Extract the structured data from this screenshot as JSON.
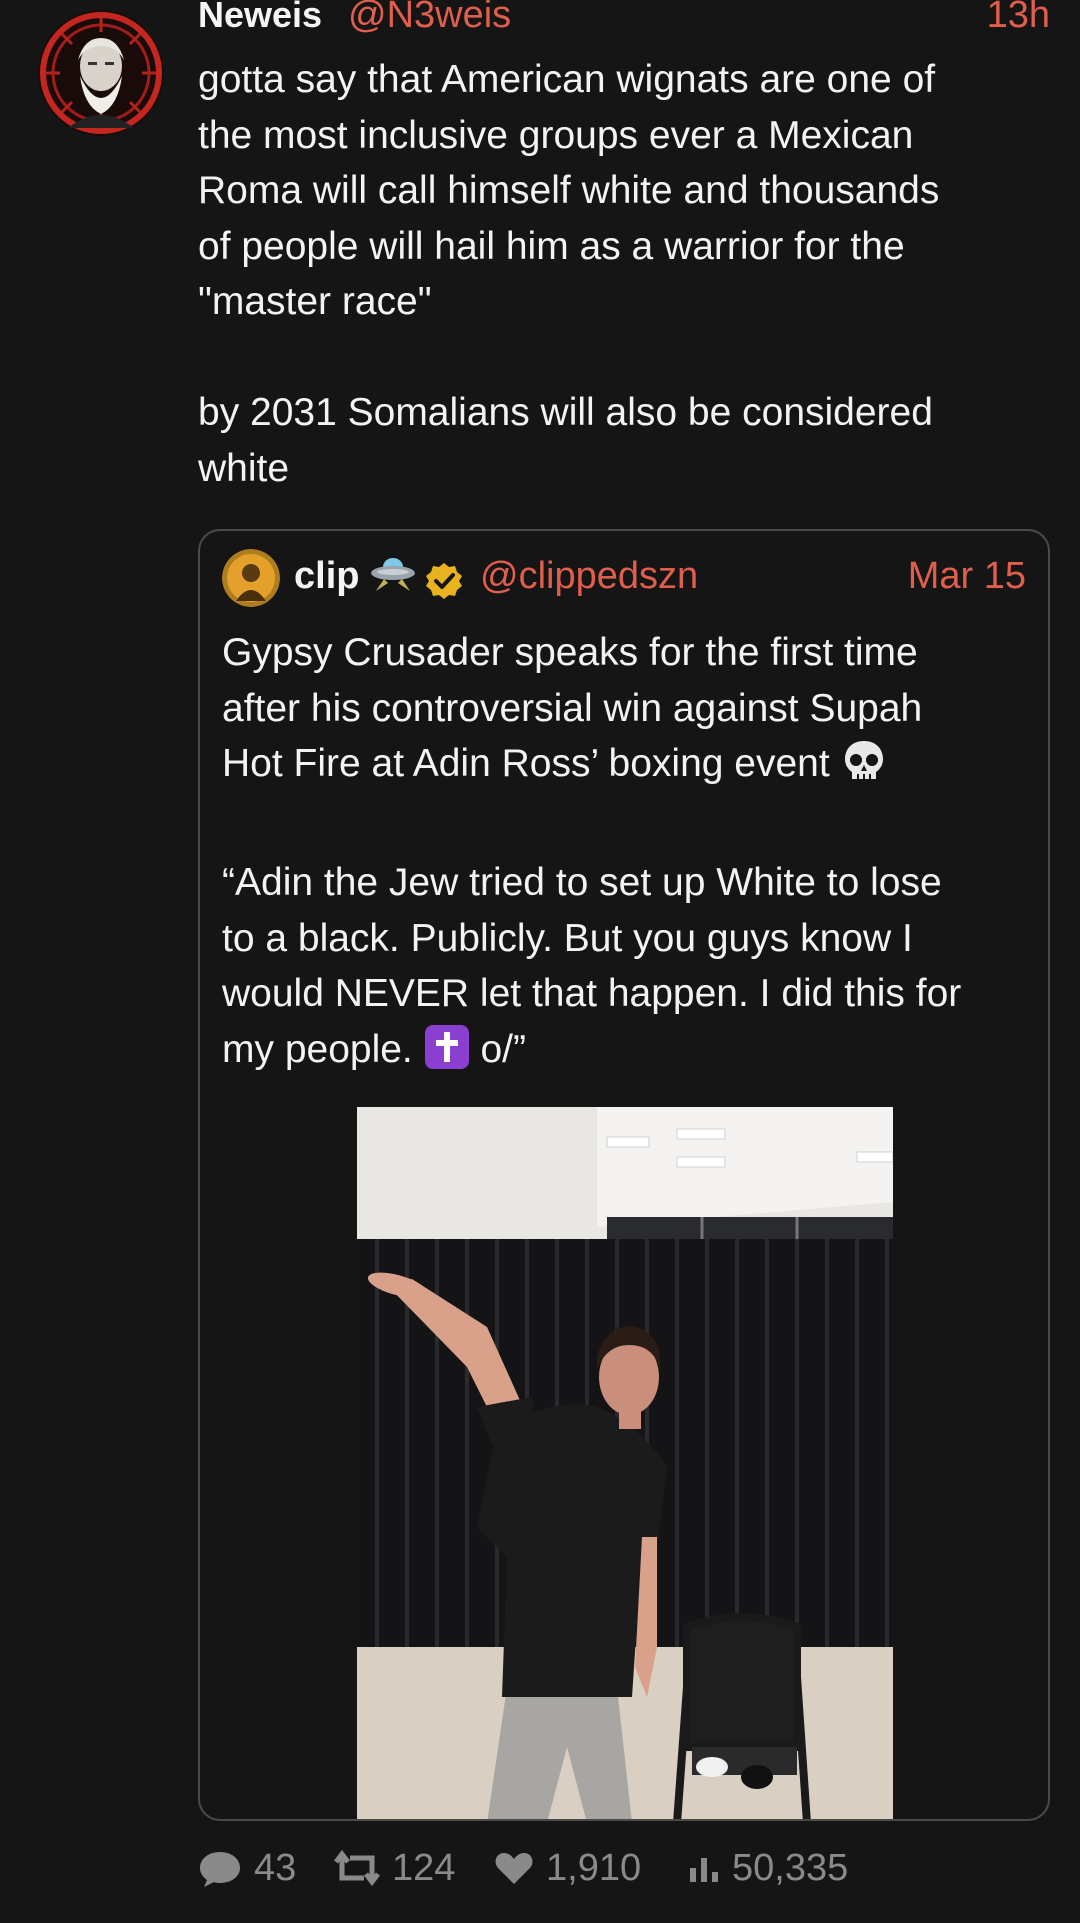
{
  "post": {
    "display_name": "Neweis",
    "handle": "@N3weis",
    "time": "13h",
    "text": "gotta say that American wignats are one of\nthe most inclusive groups ever a Mexican\nRoma will call himself white and thousands\nof people will hail him as a warrior for the\n\"master race\"\n\nby 2031 Somalians will also be considered\nwhite",
    "avatar_icon": "bearded-man-portrait-red-halo"
  },
  "quoted": {
    "display_name": "clip",
    "handle": "@clippedszn",
    "date": "Mar 15",
    "name_emoji": "flying-saucer-icon",
    "verified_icon": "verified-badge-icon",
    "text_part1": "Gypsy Crusader speaks for the first time\nafter his controversial win against Supah\nHot Fire at Adin Ross’ boxing event ",
    "text_part2": "\n\n“Adin the Jew tried to set up White to lose\nto a black. Publicly. But you guys know I\nwould NEVER let that happen. I did this for\nmy people. ",
    "text_part3": " o/”",
    "media_icon": "photo-of-man-raising-arm-in-room"
  },
  "stats": {
    "replies": "43",
    "reposts": "124",
    "likes": "1,910",
    "views": "50,335"
  },
  "colors": {
    "background": "#151515",
    "accent": "#e05e4c",
    "muted": "#8a8a8a",
    "border": "#4a4a4a"
  }
}
